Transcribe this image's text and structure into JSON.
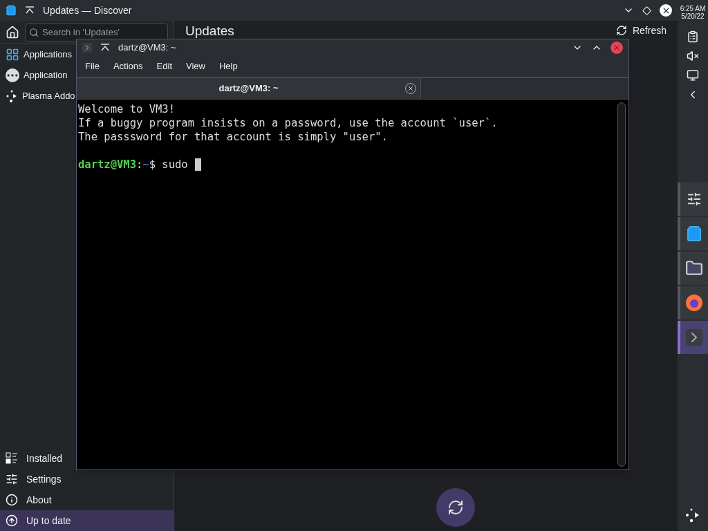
{
  "discover": {
    "title": "Updates — Discover",
    "search": {
      "placeholder": "Search in 'Updates'"
    },
    "heading": "Updates",
    "refresh": "Refresh",
    "nav": [
      {
        "label": "Applications",
        "kind": "apps"
      },
      {
        "label": "Application",
        "kind": "addons"
      },
      {
        "label": "Plasma Addo",
        "kind": "plasma"
      }
    ],
    "bottom_nav": [
      {
        "label": "Installed",
        "kind": "installed",
        "selected": false
      },
      {
        "label": "Settings",
        "kind": "settings",
        "selected": false
      },
      {
        "label": "About",
        "kind": "about",
        "selected": false
      },
      {
        "label": "Up to date",
        "kind": "update",
        "selected": true
      }
    ]
  },
  "terminal": {
    "title": "dartz@VM3: ~",
    "menu": [
      "File",
      "Actions",
      "Edit",
      "View",
      "Help"
    ],
    "tab": "dartz@VM3: ~",
    "lines": [
      "Welcome to VM3!",
      "If a buggy program insists on a password, use the account `user`.",
      "The passsword for that account is simply \"user\"."
    ],
    "prompt": {
      "user": "dartz@VM3",
      "separator": ":",
      "path": "~",
      "symbol": "$",
      "command": "sudo"
    }
  },
  "system": {
    "time": "6:25 AM",
    "date": "5/20/22"
  },
  "dock": [
    {
      "kind": "settings",
      "selected": false
    },
    {
      "kind": "store",
      "selected": false
    },
    {
      "kind": "files",
      "selected": false
    },
    {
      "kind": "browser",
      "selected": false
    },
    {
      "kind": "terminal",
      "selected": true
    }
  ]
}
